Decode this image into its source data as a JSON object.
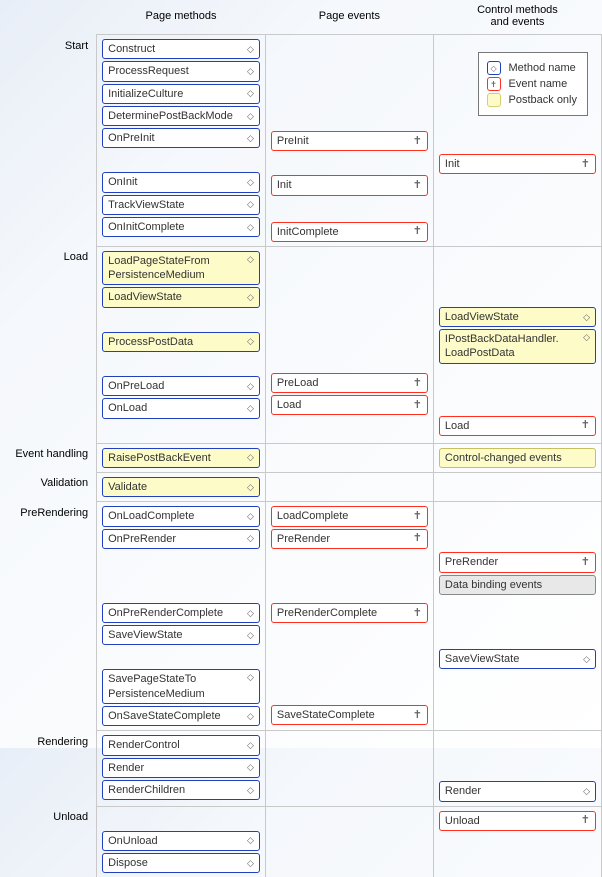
{
  "columns": [
    "Page methods",
    "Page events",
    "Control methods\nand events"
  ],
  "phases": {
    "start": "Start",
    "load": "Load",
    "event_handling": "Event handling",
    "validation": "Validation",
    "prerendering": "PreRendering",
    "rendering": "Rendering",
    "unload": "Unload"
  },
  "legend": {
    "method": "Method name",
    "event": "Event name",
    "postback": "Postback only"
  },
  "start": {
    "pm": [
      "Construct",
      "ProcessRequest",
      "InitializeCulture",
      "DeterminePostBackMode",
      "OnPreInit",
      "OnInit",
      "TrackViewState",
      "OnInitComplete"
    ],
    "pe": {
      "preinit": "PreInit",
      "init": "Init",
      "initcomplete": "InitComplete"
    },
    "ctrl": {
      "init": "Init"
    }
  },
  "load": {
    "pm": {
      "loadpagestate": "LoadPageStateFrom\nPersistenceMedium",
      "loadviewstate": "LoadViewState",
      "processpost": "ProcessPostData",
      "onpreload": "OnPreLoad",
      "onload": "OnLoad"
    },
    "pe": {
      "preload": "PreLoad",
      "load": "Load"
    },
    "ctrl": {
      "loadviewstate": "LoadViewState",
      "ipostback": "IPostBackDataHandler.\nLoadPostData",
      "load": "Load"
    }
  },
  "eh": {
    "pm": "RaisePostBackEvent",
    "ctrl": "Control-changed events"
  },
  "validation": {
    "pm": "Validate"
  },
  "prerender": {
    "pm": {
      "onloadcomplete": "OnLoadComplete",
      "onprerender": "OnPreRender",
      "onprerendercomplete": "OnPreRenderComplete",
      "saveviewstate": "SaveViewState",
      "savepagestate": "SavePageStateTo\nPersistenceMedium",
      "onsavestatecomplete": "OnSaveStateComplete"
    },
    "pe": {
      "loadcomplete": "LoadComplete",
      "prerender": "PreRender",
      "prerendercomplete": "PreRenderComplete",
      "savestatecomplete": "SaveStateComplete"
    },
    "ctrl": {
      "prerender": "PreRender",
      "databinding": "Data binding events",
      "saveviewstate": "SaveViewState"
    }
  },
  "rendering": {
    "pm": [
      "RenderControl",
      "Render",
      "RenderChildren"
    ],
    "ctrl": {
      "render": "Render"
    }
  },
  "unload": {
    "pm": [
      "OnUnload",
      "Dispose"
    ],
    "ctrl": {
      "unload": "Unload"
    }
  }
}
